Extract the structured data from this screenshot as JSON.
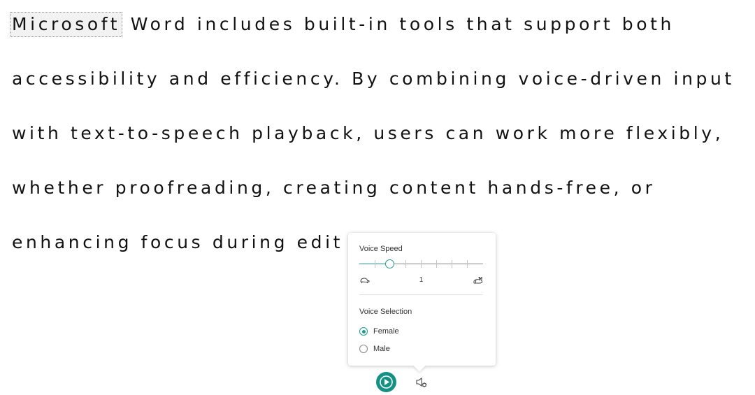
{
  "document": {
    "line1_highlight": "Microsoft",
    "line1_rest": " Word includes built-in tools that support both",
    "line2": "accessibility and efficiency. By combining voice-driven input",
    "line3": "with text-to-speech playback, users can work more flexibly,",
    "line4": "whether proofreading, creating content hands-free, or",
    "line5": "enhancing focus during edit"
  },
  "popup": {
    "voice_speed_label": "Voice Speed",
    "speed_value": "1",
    "speed_level_fraction": 0.25,
    "voice_selection_label": "Voice Selection",
    "options": [
      "Female",
      "Male"
    ],
    "selected": "Female"
  },
  "icons": {
    "slow": "tortoise-icon",
    "fast": "rabbit-icon",
    "play": "play-icon",
    "settings": "voice-settings-icon"
  },
  "colors": {
    "accent": "#139184"
  }
}
